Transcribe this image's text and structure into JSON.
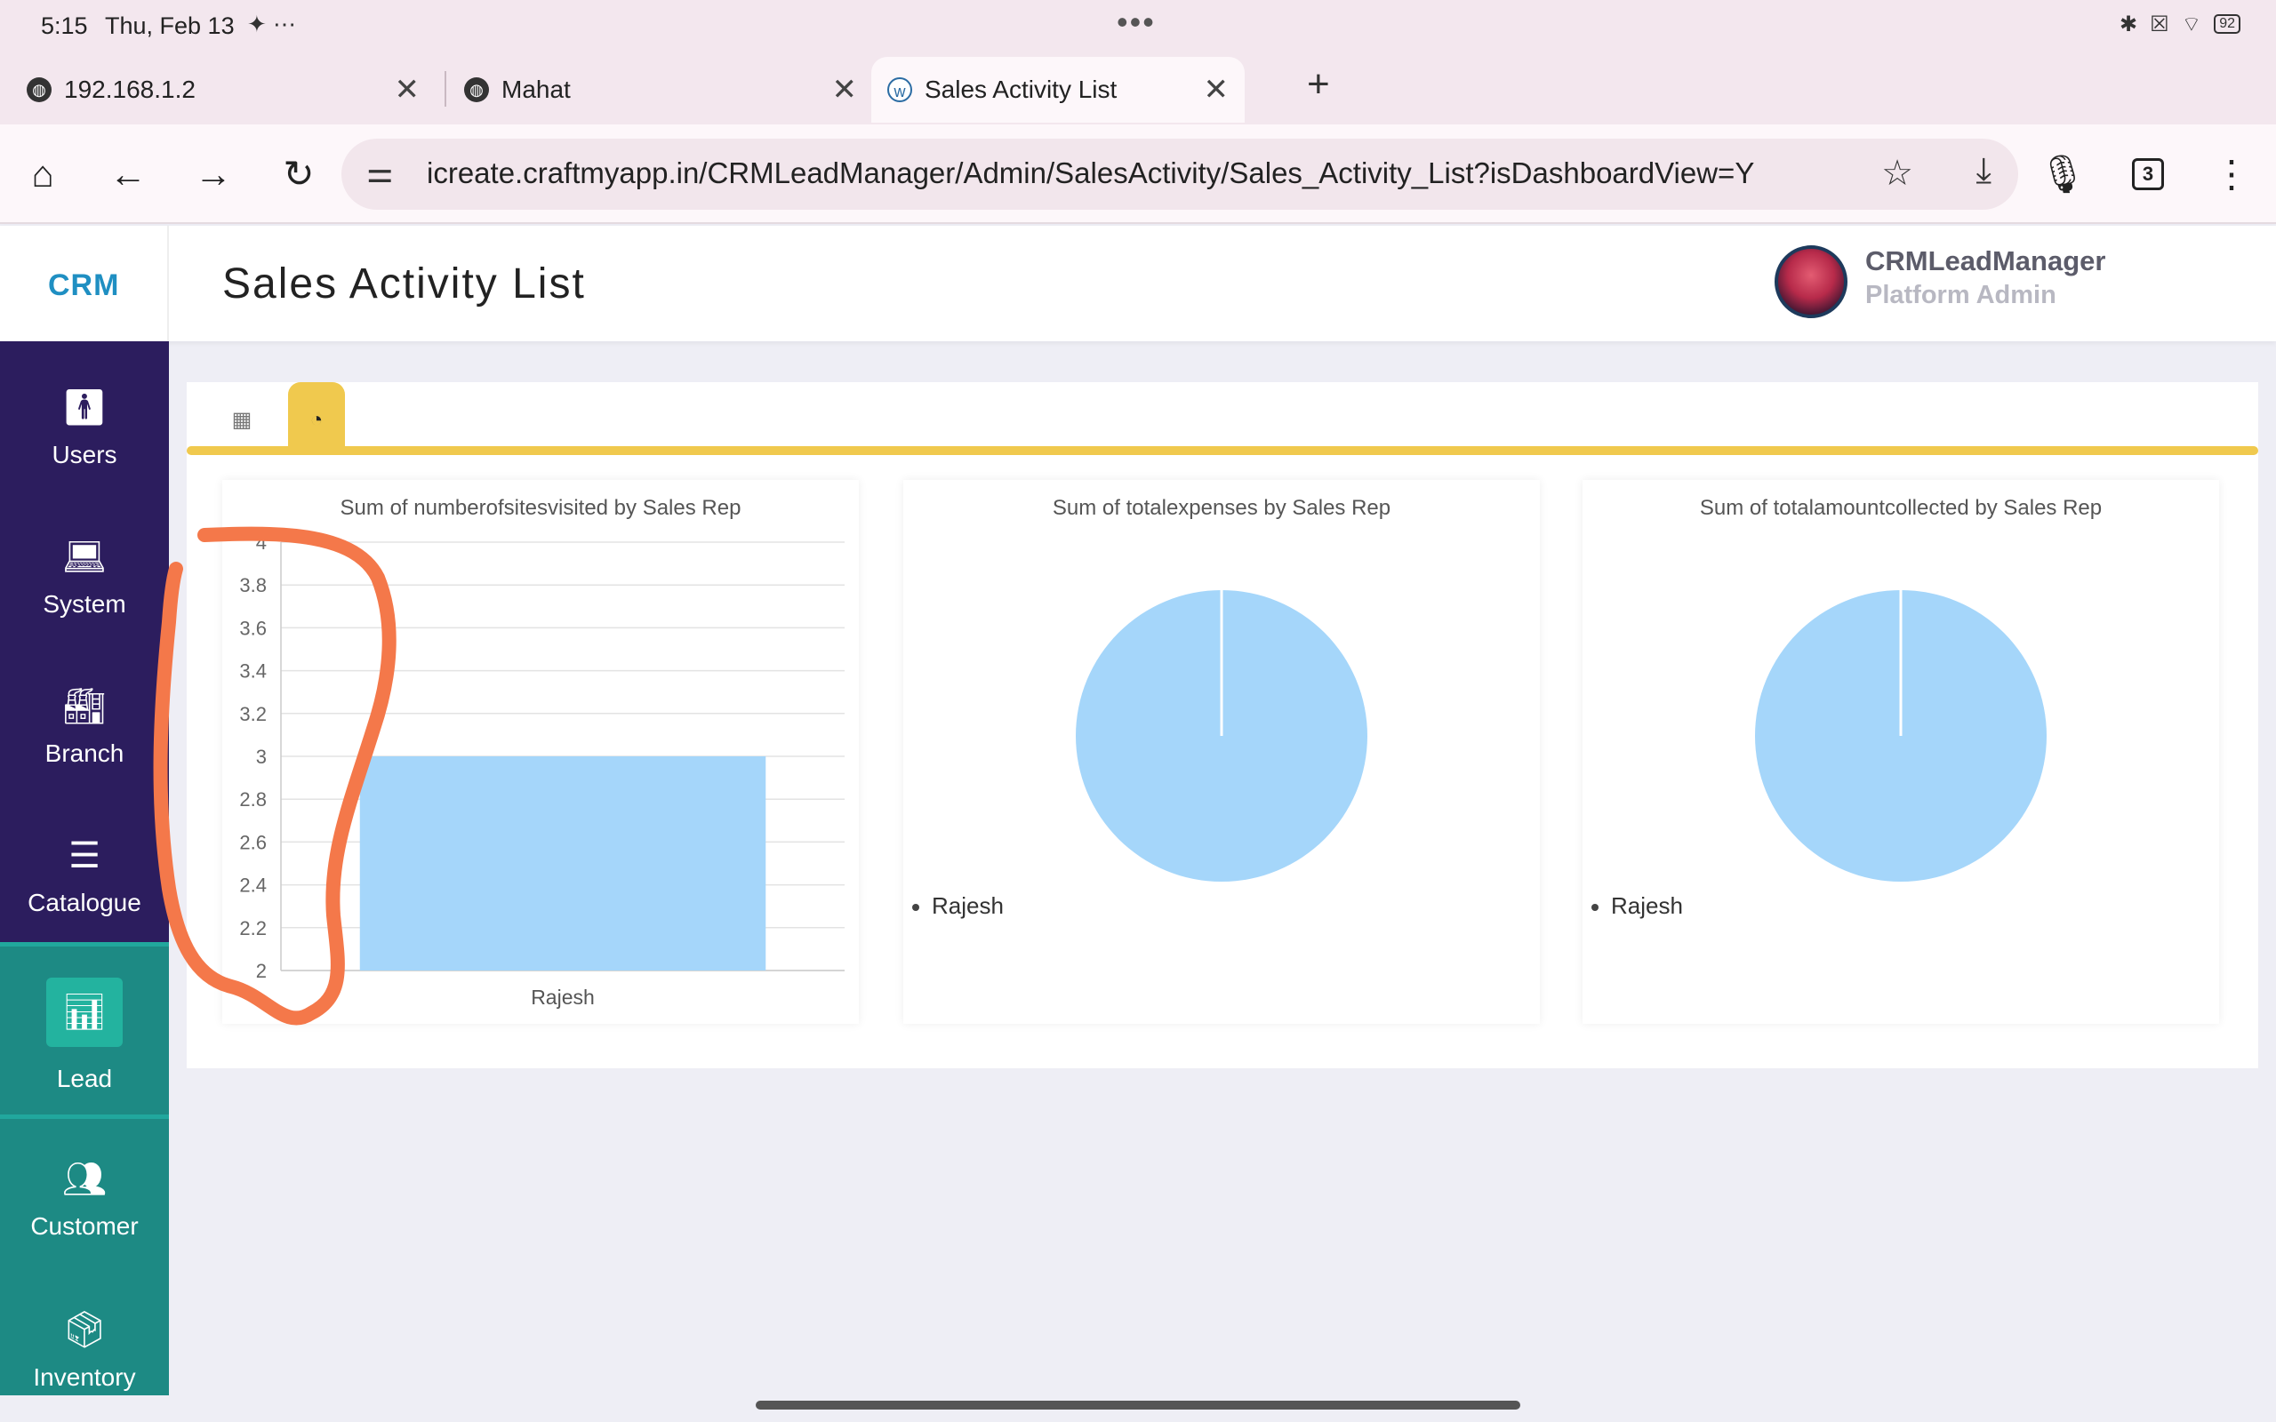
{
  "status_bar": {
    "time": "5:15",
    "date": "Thu, Feb 13",
    "notifications": "✦ ⋯",
    "battery": "92"
  },
  "browser": {
    "tabs": [
      {
        "title": "192.168.1.2"
      },
      {
        "title": "Mahat"
      },
      {
        "title": "Sales Activity List"
      }
    ],
    "url": "icreate.craftmyapp.in/CRMLeadManager/Admin/SalesActivity/Sales_Activity_List?isDashboardView=Y",
    "tab_count": "3"
  },
  "app": {
    "logo": "CRM",
    "page_title": "Sales Activity List",
    "user": {
      "name": "CRMLeadManager",
      "role": "Platform Admin"
    }
  },
  "sidebar": {
    "items": [
      {
        "label": "Users",
        "icon": "user-icon"
      },
      {
        "label": "System",
        "icon": "laptop-icon"
      },
      {
        "label": "Branch",
        "icon": "factory-icon"
      },
      {
        "label": "Catalogue",
        "icon": "list-icon"
      },
      {
        "label": "Lead",
        "icon": "bar-chart-icon"
      },
      {
        "label": "Customer",
        "icon": "users-group-icon"
      },
      {
        "label": "Inventory",
        "icon": "boxes-icon"
      }
    ],
    "colors": {
      "primary": "#2c1d5e",
      "teal": "#1d8a84",
      "active": "#23b39f"
    }
  },
  "view_tabs": {
    "active": "chart",
    "accent": "#f0c94e"
  },
  "chart_data": [
    {
      "type": "bar",
      "title": "Sum of numberofsitesvisited by Sales Rep",
      "categories": [
        "Rajesh"
      ],
      "values": [
        3
      ],
      "ylim": [
        2,
        4
      ],
      "yticks": [
        "4",
        "3.8",
        "3.6",
        "3.4",
        "3.2",
        "3",
        "2.8",
        "2.6",
        "2.4",
        "2.2",
        "2"
      ],
      "color": "#a5d6fa"
    },
    {
      "type": "pie",
      "title": "Sum of totalexpenses by Sales Rep",
      "labels": [
        "Rajesh"
      ],
      "values": [
        1
      ],
      "color": "#a5d6fa"
    },
    {
      "type": "pie",
      "title": "Sum of totalamountcollected by Sales Rep",
      "labels": [
        "Rajesh"
      ],
      "values": [
        1
      ],
      "color": "#a5d6fa"
    }
  ]
}
